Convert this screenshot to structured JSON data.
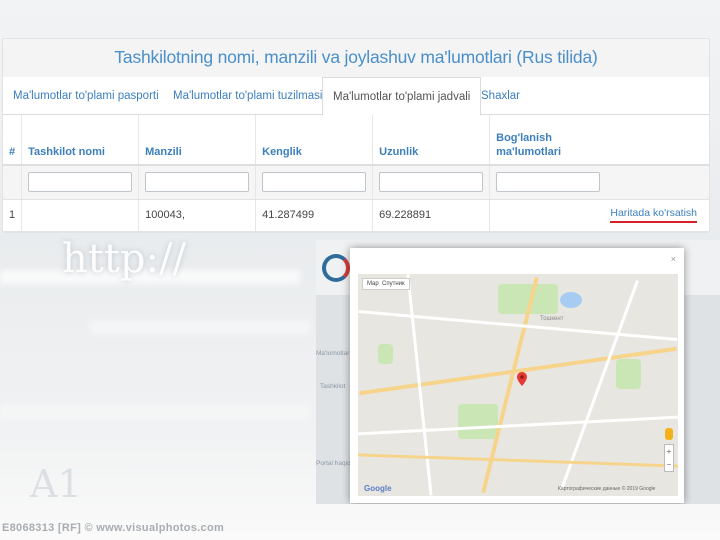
{
  "page": {
    "title": "Tashkilotning nomi, manzili va joylashuv ma'lumotlari (Rus tilida)",
    "tabs": [
      {
        "label": "Ma'lumotlar to'plami pasporti"
      },
      {
        "label": "Ma'lumotlar to'plami tuzilmasi"
      },
      {
        "label": "Ma'lumotlar to'plami jadvali"
      },
      {
        "label": "Shaxlar"
      }
    ],
    "table": {
      "headers": [
        "#",
        "Tashkilot nomi",
        "Manzili",
        "Kenglik",
        "Uzunlik",
        "Bog'lanish ma'lumotlari"
      ],
      "rows": [
        {
          "num": "1",
          "name": "",
          "address": "100043,",
          "lat": "41.287499",
          "lon": "69.228891",
          "link": "Haritada ko'rsatish"
        }
      ]
    }
  },
  "background": {
    "http_text": "http://",
    "big_text": "A1",
    "watermark": "E8068313 [RF] © www.visualphotos.com"
  },
  "map_modal": {
    "map_tab": "Map",
    "satellite_tab": "Спутник",
    "close": "×",
    "city_label": "Тошкент",
    "google": "Google",
    "footer": "Картографические данные © 2019 Google",
    "zoom_in": "+",
    "zoom_out": "−",
    "pin_color": "#e53935"
  }
}
